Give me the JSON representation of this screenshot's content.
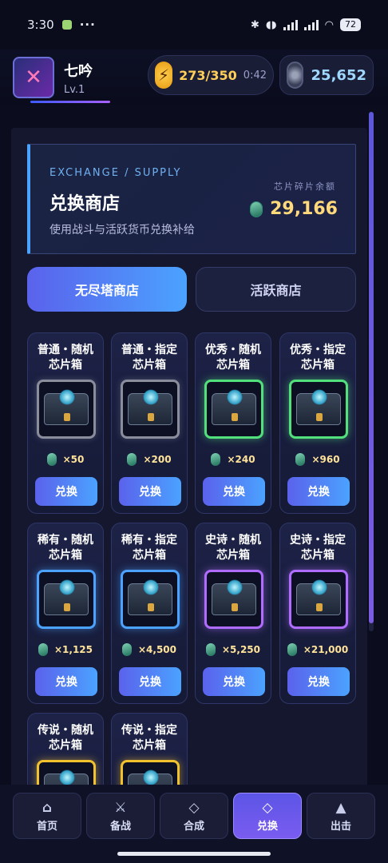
{
  "status_bar": {
    "time": "3:30",
    "dots": "···",
    "battery": "72"
  },
  "header": {
    "username": "七吟",
    "level": "Lv.1",
    "energy": "273/350",
    "energy_timer": "0:42",
    "chips": "25,652"
  },
  "banner": {
    "eyebrow": "EXCHANGE / SUPPLY",
    "title": "兑换商店",
    "description": "使用战斗与活跃货币兑换补给",
    "balance_label": "芯片碎片余额",
    "balance_value": "29,166"
  },
  "tabs": [
    {
      "label": "无尽塔商店",
      "active": true
    },
    {
      "label": "活跃商店",
      "active": false
    }
  ],
  "items": [
    {
      "line1": "普通・随机",
      "line2": "芯片箱",
      "cost": "×50",
      "rarity": "grey"
    },
    {
      "line1": "普通・指定",
      "line2": "芯片箱",
      "cost": "×200",
      "rarity": "grey"
    },
    {
      "line1": "优秀・随机",
      "line2": "芯片箱",
      "cost": "×240",
      "rarity": "green"
    },
    {
      "line1": "优秀・指定",
      "line2": "芯片箱",
      "cost": "×960",
      "rarity": "green"
    },
    {
      "line1": "稀有・随机",
      "line2": "芯片箱",
      "cost": "×1,125",
      "rarity": "blue"
    },
    {
      "line1": "稀有・指定",
      "line2": "芯片箱",
      "cost": "×4,500",
      "rarity": "blue"
    },
    {
      "line1": "史诗・随机",
      "line2": "芯片箱",
      "cost": "×5,250",
      "rarity": "purple"
    },
    {
      "line1": "史诗・指定",
      "line2": "芯片箱",
      "cost": "×21,000",
      "rarity": "purple"
    },
    {
      "line1": "传说・随机",
      "line2": "芯片箱",
      "cost": "",
      "rarity": "gold"
    },
    {
      "line1": "传说・指定",
      "line2": "芯片箱",
      "cost": "",
      "rarity": "gold"
    }
  ],
  "redeem_label": "兑换",
  "nav": [
    {
      "label": "首页",
      "icon": "home-icon",
      "active": false
    },
    {
      "label": "备战",
      "icon": "crossed-swords-icon",
      "active": false
    },
    {
      "label": "合成",
      "icon": "diamond-outline-icon",
      "active": false
    },
    {
      "label": "兑换",
      "icon": "diamond-outline-icon",
      "active": true
    },
    {
      "label": "出击",
      "icon": "triangle-icon",
      "active": false
    }
  ],
  "colors": {
    "accent": "#5a62ec",
    "accent2": "#4ba2ff",
    "gold_text": "#ffd97a",
    "grey": "#8a8e9c",
    "green": "#52e07c",
    "blue": "#4ba2ff",
    "purple": "#b06cff",
    "gold": "#f2c12e"
  }
}
